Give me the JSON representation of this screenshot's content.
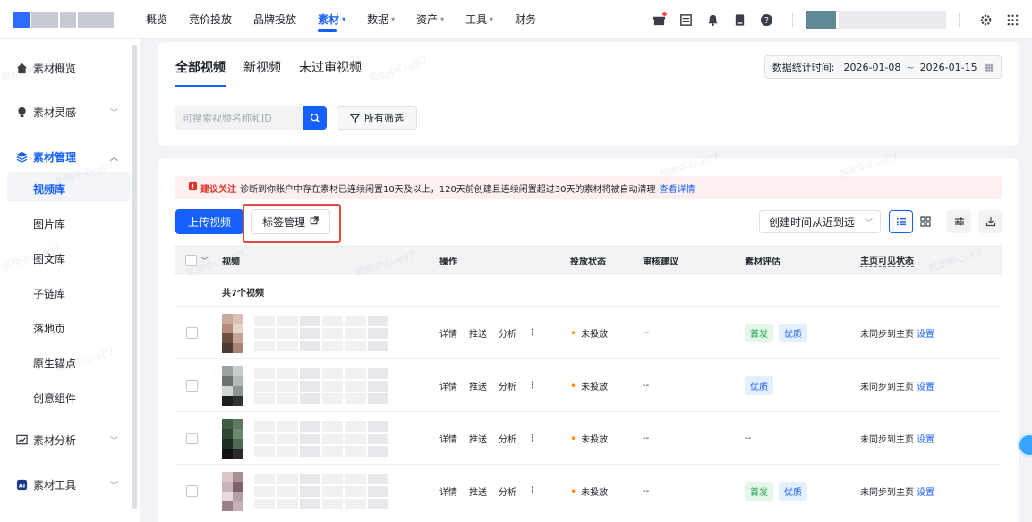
{
  "nav": {
    "items": [
      {
        "label": "概览",
        "caret": false,
        "active": false
      },
      {
        "label": "竞价投放",
        "caret": false,
        "active": false
      },
      {
        "label": "品牌投放",
        "caret": false,
        "active": false
      },
      {
        "label": "素材",
        "caret": true,
        "active": true
      },
      {
        "label": "数据",
        "caret": true,
        "active": false
      },
      {
        "label": "资产",
        "caret": true,
        "active": false
      },
      {
        "label": "工具",
        "caret": true,
        "active": false
      },
      {
        "label": "财务",
        "caret": false,
        "active": false
      }
    ]
  },
  "sidebar": {
    "groups": {
      "overview": "素材概览",
      "inspiration": "素材灵感",
      "manage": "素材管理",
      "analysis": "素材分析",
      "tools": "素材工具"
    },
    "items": [
      "视频库",
      "图片库",
      "图文库",
      "子链库",
      "落地页",
      "原生锚点",
      "创意组件"
    ]
  },
  "filter": {
    "tabs": [
      "全部视频",
      "新视频",
      "未过审视频"
    ],
    "date_label": "数据统计时间:",
    "date_start": "2026-01-08",
    "date_sep": "~",
    "date_end": "2026-01-15",
    "search_placeholder": "可搜索视频名称和ID",
    "all_filters": "所有筛选"
  },
  "notice": {
    "title": "建议关注",
    "text": "诊断到你账户中存在素材已连续闲置10天及以上，120天前创建且连续闲置超过30天的素材将被自动清理",
    "link": "查看详情"
  },
  "toolbar": {
    "upload": "上传视频",
    "tag_manage": "标签管理",
    "sort": "创建时间从近到远"
  },
  "table": {
    "headers": {
      "video": "视频",
      "ops": "操作",
      "status": "投放状态",
      "review": "审核建议",
      "eval": "素材评估",
      "visible": "主页可见状态"
    },
    "count": "共7个视频",
    "op_labels": {
      "detail": "详情",
      "push": "推送",
      "analyze": "分析",
      "more": "⋮"
    },
    "rows": [
      {
        "status": "未投放",
        "review": "--",
        "badges": [
          "首发",
          "优质"
        ],
        "eval_text": "",
        "visible": "未同步到主页",
        "set": "设置"
      },
      {
        "status": "未投放",
        "review": "--",
        "badges": [
          "优质"
        ],
        "eval_text": "",
        "visible": "未同步到主页",
        "set": "设置"
      },
      {
        "status": "未投放",
        "review": "--",
        "badges": [],
        "eval_text": "--",
        "visible": "未同步到主页",
        "set": "设置"
      },
      {
        "status": "未投放",
        "review": "--",
        "badges": [
          "首发",
          "优质"
        ],
        "eval_text": "",
        "visible": "未同步到主页",
        "set": "设置"
      }
    ]
  },
  "watermark": "帮助中心-e07",
  "colors": {
    "primary": "#1660ff",
    "warn": "#e0342b",
    "highlight": "#e34841"
  }
}
